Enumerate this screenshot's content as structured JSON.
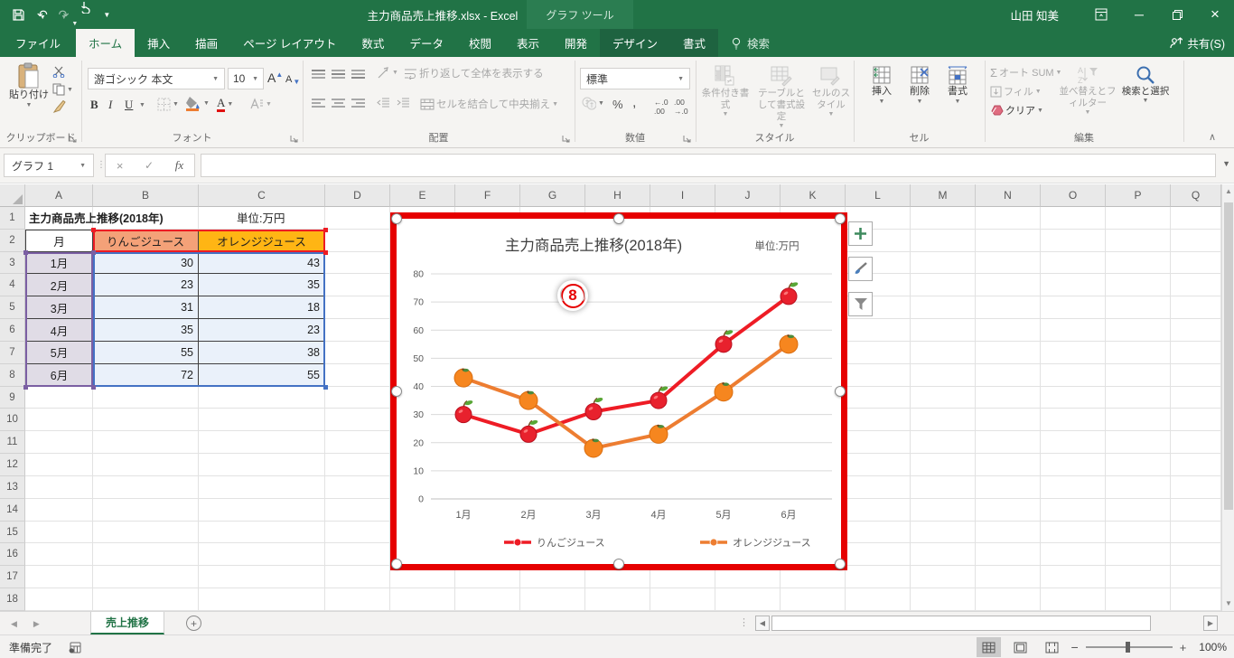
{
  "titlebar": {
    "title": "主力商品売上推移.xlsx - Excel",
    "context_title": "グラフ ツール",
    "user_name": "山田 知美"
  },
  "tabs": {
    "file": "ファイル",
    "items": [
      "ホーム",
      "挿入",
      "描画",
      "ページ レイアウト",
      "数式",
      "データ",
      "校閲",
      "表示",
      "開発"
    ],
    "active": "ホーム",
    "contextual": [
      "デザイン",
      "書式"
    ],
    "search": "検索",
    "share": "共有(S)"
  },
  "ribbon": {
    "clipboard": {
      "label": "クリップボード",
      "paste": "貼り付け"
    },
    "font": {
      "label": "フォント",
      "font_name": "游ゴシック 本文",
      "font_size": "10",
      "bold": "B",
      "italic": "I",
      "underline": "U"
    },
    "alignment": {
      "label": "配置",
      "wrap": "折り返して全体を表示する",
      "merge": "セルを結合して中央揃え"
    },
    "number": {
      "label": "数値",
      "format": "標準"
    },
    "styles": {
      "label": "スタイル",
      "conditional": "条件付き書式",
      "table": "テーブルとして書式設定",
      "cell_styles": "セルのスタイル"
    },
    "cells": {
      "label": "セル",
      "insert": "挿入",
      "delete": "削除",
      "format": "書式"
    },
    "editing": {
      "label": "編集",
      "autosum": "オート SUM",
      "fill": "フィル",
      "clear": "クリア",
      "sort": "並べ替えとフィルター",
      "find": "検索と選択"
    }
  },
  "formula_bar": {
    "name_box": "グラフ 1",
    "fx": "fx"
  },
  "sheet": {
    "columns": [
      "A",
      "B",
      "C",
      "D",
      "E",
      "F",
      "G",
      "H",
      "I",
      "J",
      "K",
      "L",
      "M",
      "N",
      "O",
      "P",
      "Q"
    ],
    "rows": [
      1,
      2,
      3,
      4,
      5,
      6,
      7,
      8,
      9,
      10,
      11,
      12,
      13,
      14,
      15,
      16,
      17,
      18
    ],
    "title_cell": "主力商品売上推移(2018年)",
    "unit_cell": "単位:万円",
    "table": {
      "headers": [
        "月",
        "りんごジュース",
        "オレンジジュース"
      ],
      "rows": [
        [
          "1月",
          "30",
          "43"
        ],
        [
          "2月",
          "23",
          "35"
        ],
        [
          "3月",
          "31",
          "18"
        ],
        [
          "4月",
          "35",
          "23"
        ],
        [
          "5月",
          "55",
          "38"
        ],
        [
          "6月",
          "72",
          "55"
        ]
      ]
    },
    "colors": {
      "apple_header_fill": "#F4A178",
      "orange_header_fill": "#FFB514",
      "category_fill": "#E0DCE6",
      "value_fill": "#EAF1FA"
    }
  },
  "chart_data": {
    "type": "line",
    "title": "主力商品売上推移(2018年)",
    "subtitle": "単位:万円",
    "categories": [
      "1月",
      "2月",
      "3月",
      "4月",
      "5月",
      "6月"
    ],
    "series": [
      {
        "name": "りんごジュース",
        "color": "#ee1c25",
        "marker": "apple",
        "values": [
          30,
          23,
          31,
          35,
          55,
          72
        ]
      },
      {
        "name": "オレンジジュース",
        "color": "#ed7d31",
        "marker": "orange",
        "values": [
          43,
          35,
          18,
          23,
          38,
          55
        ]
      }
    ],
    "ylim": [
      0,
      80
    ],
    "ytick_step": 10,
    "yticks": [
      "0",
      "10",
      "20",
      "30",
      "40",
      "50",
      "60",
      "70",
      "80"
    ],
    "grid": true,
    "legend_position": "bottom",
    "badge": "8",
    "annotation_border_color": "#e60000"
  },
  "tab_bar": {
    "sheet_name": "売上推移"
  },
  "status_bar": {
    "ready": "準備完了",
    "zoom": "100%"
  },
  "theme": {
    "excel_green": "#217346",
    "range_category_border": "#7B5FA3",
    "range_series_border": "#ED1C24",
    "range_value_border": "#4472C4"
  }
}
